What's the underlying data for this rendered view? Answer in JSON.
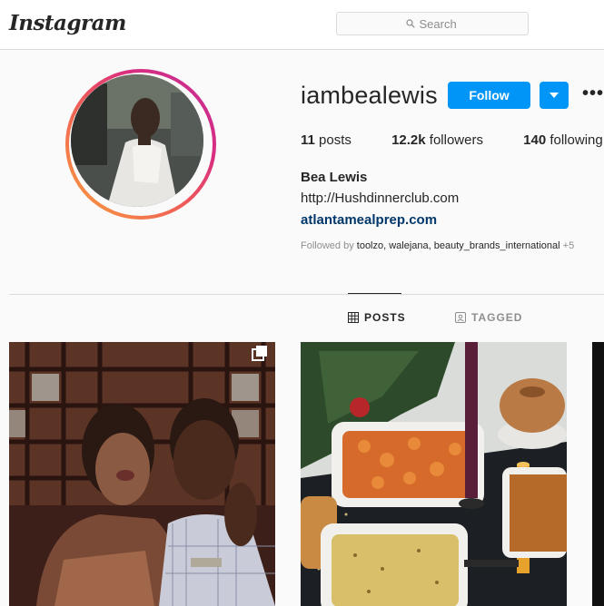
{
  "nav": {
    "logo": "Instagram",
    "search_placeholder": "Search"
  },
  "profile": {
    "username": "iambealewis",
    "follow_label": "Follow",
    "posts_count": "11",
    "posts_label": "posts",
    "followers_count": "12.2k",
    "followers_label": "followers",
    "following_count": "140",
    "following_label": "following",
    "full_name": "Bea Lewis",
    "bio": "http://Hushdinnerclub.com",
    "link": "atlantamealprep.com",
    "followed_by_prefix": "Followed by",
    "followed_by_names": "toolzo, walejana, beauty_brands_international",
    "followed_by_more": "+5"
  },
  "tabs": [
    {
      "label": "POSTS",
      "icon": "grid-icon",
      "active": true
    },
    {
      "label": "TAGGED",
      "icon": "tagged-icon",
      "active": false
    }
  ],
  "colors": {
    "accent": "#0095f6",
    "link": "#00376b",
    "muted": "#8e8e8e"
  }
}
